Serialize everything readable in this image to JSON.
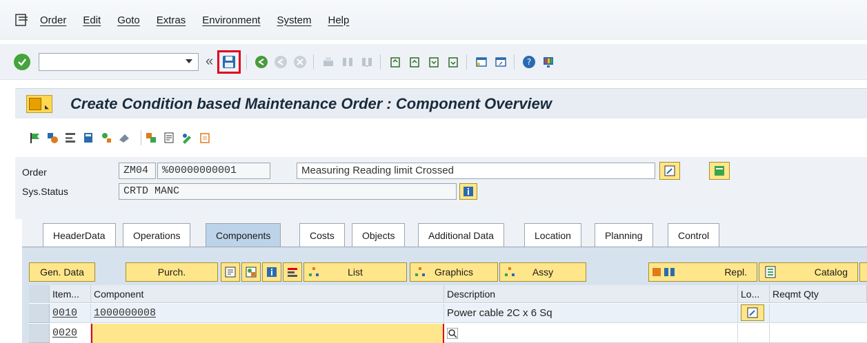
{
  "menu": {
    "items": [
      "Order",
      "Edit",
      "Goto",
      "Extras",
      "Environment",
      "System",
      "Help"
    ]
  },
  "toolbar": {
    "command_value": "",
    "icons": [
      "ok-icon",
      "save-icon",
      "back-icon",
      "exit-icon",
      "cancel-icon",
      "print-icon",
      "find-icon",
      "find-next-icon",
      "first-page-icon",
      "previous-page-icon",
      "next-page-icon",
      "last-page-icon",
      "create-session-icon",
      "generate-shortcut-icon",
      "help-icon",
      "customize-layout-icon"
    ]
  },
  "title": {
    "text": "Create Condition based Maintenance Order : Component Overview"
  },
  "header": {
    "order_label": "Order",
    "order_type": "ZM04",
    "order_number": "%00000000001",
    "order_desc": "Measuring Reading limit Crossed",
    "status_label": "Sys.Status",
    "status_value": "CRTD MANC"
  },
  "tabs": [
    {
      "label": "HeaderData",
      "active": false
    },
    {
      "label": "Operations",
      "active": false
    },
    {
      "label": "Components",
      "active": true
    },
    {
      "label": "Costs",
      "active": false
    },
    {
      "label": "Objects",
      "active": false
    },
    {
      "label": "Additional Data",
      "active": false
    },
    {
      "label": "Location",
      "active": false
    },
    {
      "label": "Planning",
      "active": false
    },
    {
      "label": "Control",
      "active": false
    }
  ],
  "component_toolbar": {
    "gen_data": "Gen. Data",
    "purch": "Purch.",
    "list": "List",
    "graphics": "Graphics",
    "assy": "Assy",
    "repl": "Repl.",
    "catalog": "Catalog"
  },
  "table": {
    "columns": [
      "Item...",
      "Component",
      "Description",
      "Lo...",
      "Reqmt Qty"
    ],
    "rows": [
      {
        "item": "0010",
        "component": "1000000008",
        "description": "Power cable 2C x 6 Sq"
      },
      {
        "item": "0020",
        "component": "",
        "description": ""
      }
    ]
  },
  "colors": {
    "accent_yellow": "#ffe68a",
    "active_tab": "#bcd3ea",
    "highlight_red": "#e0001b",
    "input_focus": "#fde68c"
  }
}
